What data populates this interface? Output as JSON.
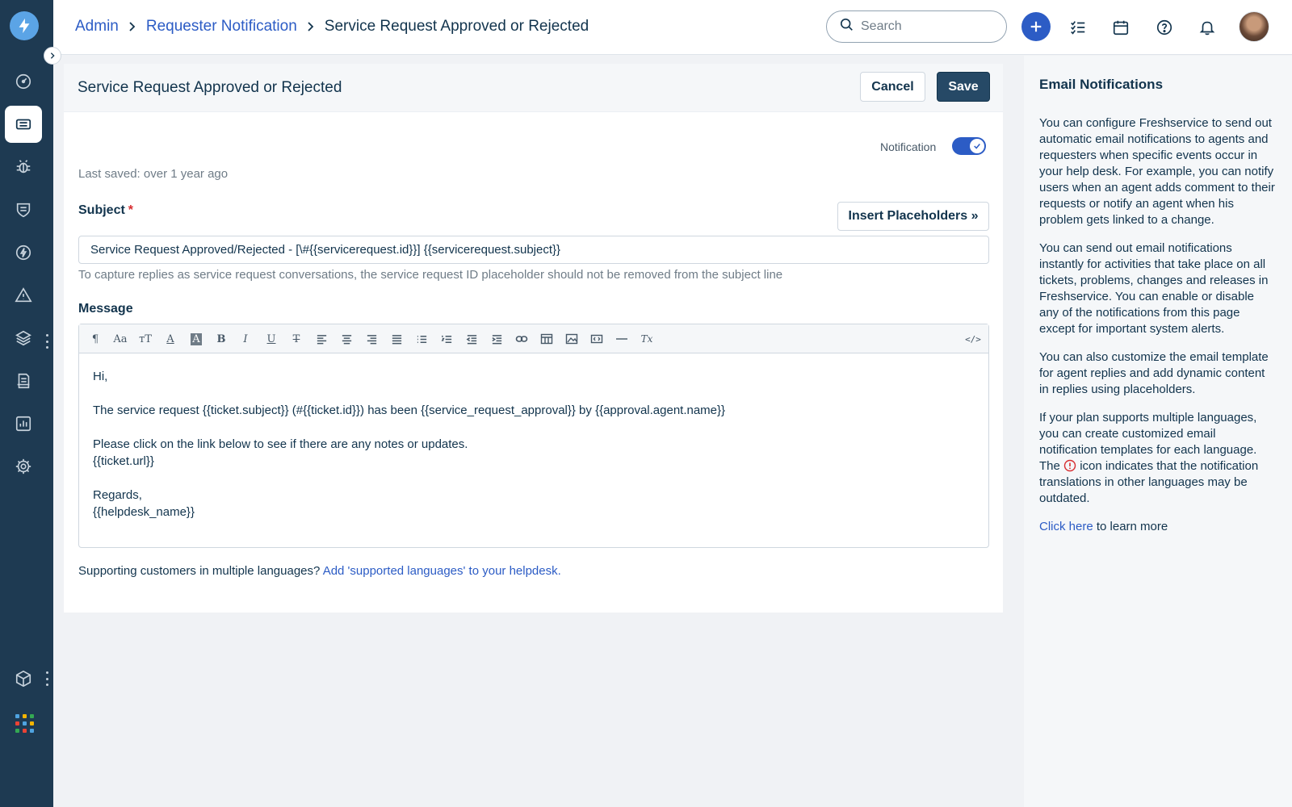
{
  "breadcrumb": {
    "admin": "Admin",
    "requester_notification": "Requester Notification",
    "current": "Service Request Approved or Rejected"
  },
  "header": {
    "search_placeholder": "Search"
  },
  "sidebar": {
    "items": [
      "dashboard-icon",
      "tickets-icon",
      "problems-icon",
      "changes-icon",
      "releases-icon",
      "alerts-icon",
      "assets-icon",
      "solutions-icon",
      "reports-icon",
      "admin-icon"
    ],
    "active_item": "tickets-icon",
    "bottom_items": [
      "packages-icon",
      "apps-icon"
    ]
  },
  "card": {
    "title": "Service Request Approved or Rejected",
    "cancel_label": "Cancel",
    "save_label": "Save",
    "notification_label": "Notification",
    "notification_enabled": true,
    "last_saved": "Last saved: over 1 year ago",
    "subject_label": "Subject",
    "required_mark": "*",
    "insert_placeholders_label": "Insert Placeholders »",
    "subject_value": "Service Request Approved/Rejected - [\\#{{servicerequest.id}}] {{servicerequest.subject}}",
    "subject_hint": "To capture replies as service request conversations, the service request ID placeholder should not be removed from the subject line",
    "message_label": "Message",
    "message_lines": {
      "l1": "Hi,",
      "l2": "",
      "l3": "The service request {{ticket.subject}} (#{{ticket.id}}) has been {{service_request_approval}} by {{approval.agent.name}}",
      "l4": "",
      "l5": "Please click on the link below to see if there are any notes or updates.",
      "l6": "{{ticket.url}}",
      "l7": "",
      "l8": "Regards,",
      "l9": "{{helpdesk_name}}"
    },
    "footer_text": "Supporting customers in multiple languages?",
    "footer_link": "Add 'supported languages' to your helpdesk."
  },
  "right_panel": {
    "title": "Email Notifications",
    "p1": "You can configure Freshservice to send out automatic email notifications to agents and requesters when specific events occur in your help desk. For example, you can notify users when an agent adds comment to their requests or notify an agent when his problem gets linked to a change.",
    "p2": "You can send out email notifications instantly for activities that take place on all tickets, problems, changes and releases in Freshservice. You can enable or disable any of the notifications from this page except for important system alerts.",
    "p3": "You can also customize the email template for agent replies and add dynamic content in replies using placeholders.",
    "p4a": "If your plan supports multiple languages, you can create customized email notification templates for each language. The",
    "p4b": "icon indicates that the notification translations in other languages may be outdated.",
    "learn_link": "Click here",
    "learn_rest": "to learn more"
  },
  "colors": {
    "sidebar": "#1e3a52",
    "accent": "#2c5cc5",
    "save_button": "#264966",
    "warning": "#d72d30"
  }
}
